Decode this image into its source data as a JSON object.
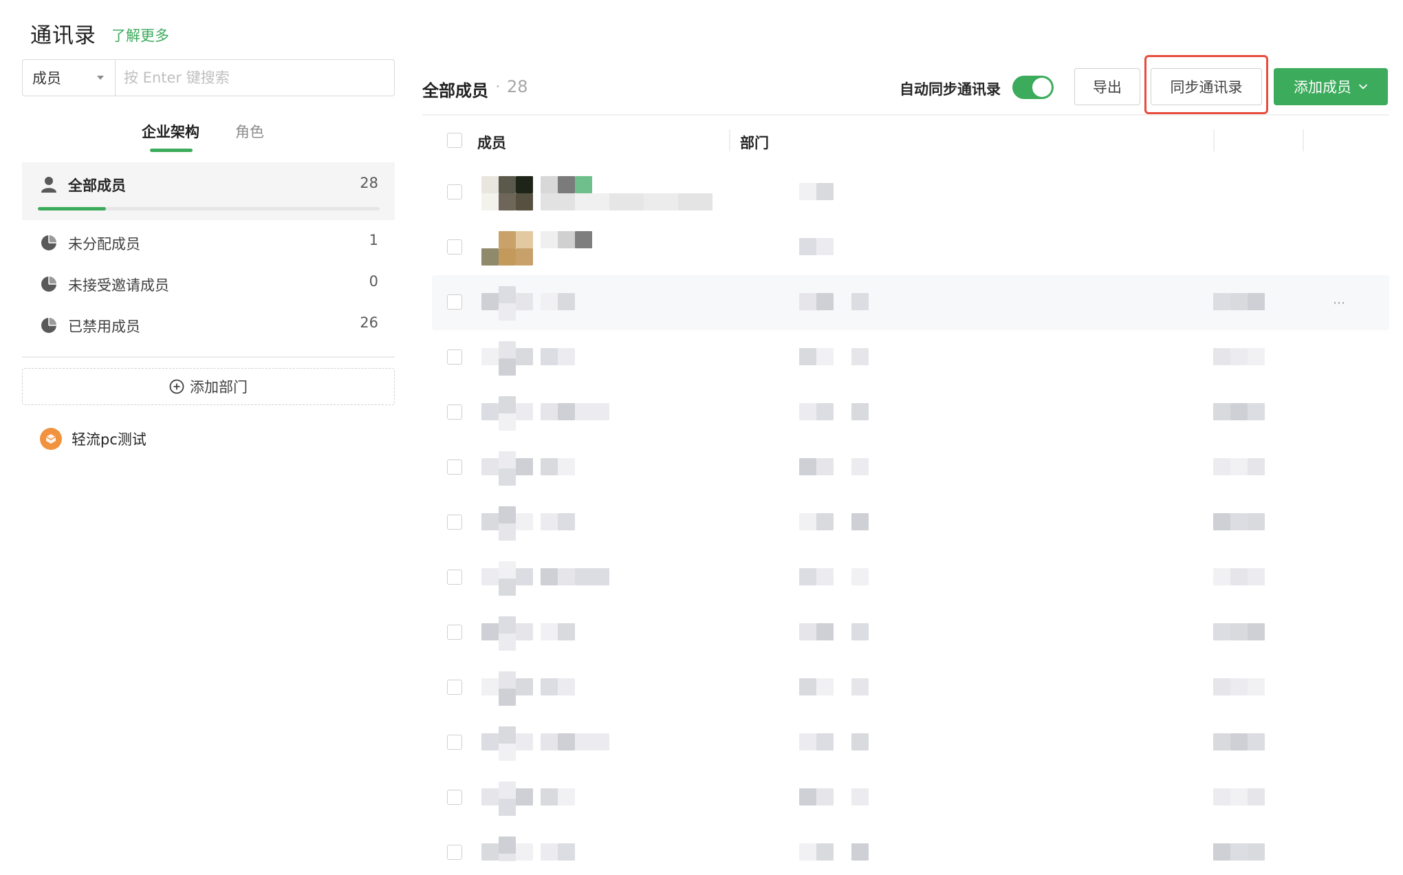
{
  "header": {
    "title": "通讯录",
    "learn_more": "了解更多"
  },
  "search": {
    "scope": "成员",
    "placeholder": "按 Enter 键搜索"
  },
  "tabs": [
    {
      "label": "企业架构",
      "active": true
    },
    {
      "label": "角色",
      "active": false
    }
  ],
  "groups": {
    "all_members": {
      "label": "全部成员",
      "count": "28",
      "progress_ratio": 0.2
    },
    "status": [
      {
        "label": "未分配成员",
        "count": "1"
      },
      {
        "label": "未接受邀请成员",
        "count": "0"
      },
      {
        "label": "已禁用成员",
        "count": "26"
      }
    ]
  },
  "add_department": "添加部门",
  "organizations": [
    {
      "label": "轻流pc测试"
    }
  ],
  "main": {
    "title": "全部成员",
    "separator": "·",
    "count": "28",
    "auto_sync_label": "自动同步通讯录",
    "auto_sync_enabled": true,
    "export_label": "导出",
    "sync_label": "同步通讯录",
    "add_member_label": "添加成员"
  },
  "table": {
    "columns": [
      "成员",
      "部门"
    ],
    "visible_row_count": 13
  },
  "colors": {
    "accent": "#3cab5c",
    "highlight_border": "#e74c3c",
    "org_logo": "#f0923e"
  }
}
